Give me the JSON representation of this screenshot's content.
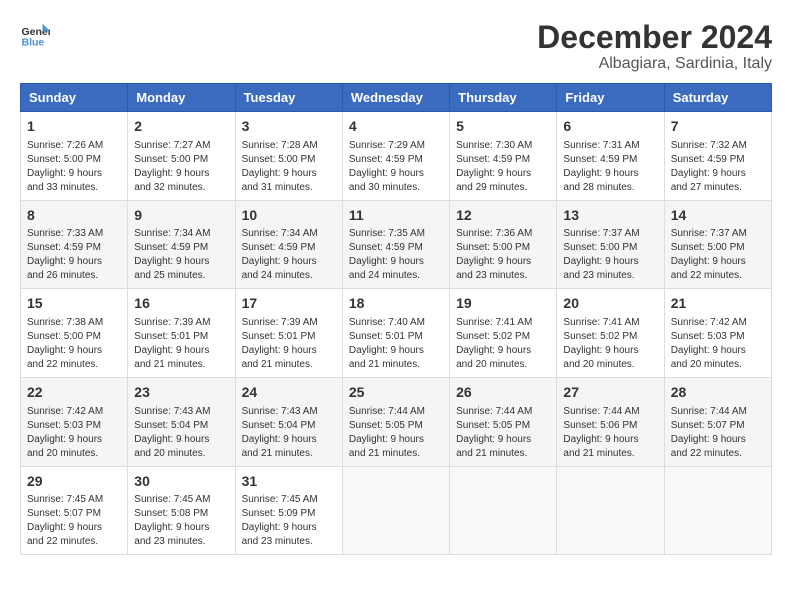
{
  "header": {
    "logo_line1": "General",
    "logo_line2": "Blue",
    "month": "December 2024",
    "location": "Albagiara, Sardinia, Italy"
  },
  "weekdays": [
    "Sunday",
    "Monday",
    "Tuesday",
    "Wednesday",
    "Thursday",
    "Friday",
    "Saturday"
  ],
  "weeks": [
    [
      {
        "day": "1",
        "sunrise": "7:26 AM",
        "sunset": "5:00 PM",
        "daylight": "9 hours and 33 minutes."
      },
      {
        "day": "2",
        "sunrise": "7:27 AM",
        "sunset": "5:00 PM",
        "daylight": "9 hours and 32 minutes."
      },
      {
        "day": "3",
        "sunrise": "7:28 AM",
        "sunset": "5:00 PM",
        "daylight": "9 hours and 31 minutes."
      },
      {
        "day": "4",
        "sunrise": "7:29 AM",
        "sunset": "4:59 PM",
        "daylight": "9 hours and 30 minutes."
      },
      {
        "day": "5",
        "sunrise": "7:30 AM",
        "sunset": "4:59 PM",
        "daylight": "9 hours and 29 minutes."
      },
      {
        "day": "6",
        "sunrise": "7:31 AM",
        "sunset": "4:59 PM",
        "daylight": "9 hours and 28 minutes."
      },
      {
        "day": "7",
        "sunrise": "7:32 AM",
        "sunset": "4:59 PM",
        "daylight": "9 hours and 27 minutes."
      }
    ],
    [
      {
        "day": "8",
        "sunrise": "7:33 AM",
        "sunset": "4:59 PM",
        "daylight": "9 hours and 26 minutes."
      },
      {
        "day": "9",
        "sunrise": "7:34 AM",
        "sunset": "4:59 PM",
        "daylight": "9 hours and 25 minutes."
      },
      {
        "day": "10",
        "sunrise": "7:34 AM",
        "sunset": "4:59 PM",
        "daylight": "9 hours and 24 minutes."
      },
      {
        "day": "11",
        "sunrise": "7:35 AM",
        "sunset": "4:59 PM",
        "daylight": "9 hours and 24 minutes."
      },
      {
        "day": "12",
        "sunrise": "7:36 AM",
        "sunset": "5:00 PM",
        "daylight": "9 hours and 23 minutes."
      },
      {
        "day": "13",
        "sunrise": "7:37 AM",
        "sunset": "5:00 PM",
        "daylight": "9 hours and 23 minutes."
      },
      {
        "day": "14",
        "sunrise": "7:37 AM",
        "sunset": "5:00 PM",
        "daylight": "9 hours and 22 minutes."
      }
    ],
    [
      {
        "day": "15",
        "sunrise": "7:38 AM",
        "sunset": "5:00 PM",
        "daylight": "9 hours and 22 minutes."
      },
      {
        "day": "16",
        "sunrise": "7:39 AM",
        "sunset": "5:01 PM",
        "daylight": "9 hours and 21 minutes."
      },
      {
        "day": "17",
        "sunrise": "7:39 AM",
        "sunset": "5:01 PM",
        "daylight": "9 hours and 21 minutes."
      },
      {
        "day": "18",
        "sunrise": "7:40 AM",
        "sunset": "5:01 PM",
        "daylight": "9 hours and 21 minutes."
      },
      {
        "day": "19",
        "sunrise": "7:41 AM",
        "sunset": "5:02 PM",
        "daylight": "9 hours and 20 minutes."
      },
      {
        "day": "20",
        "sunrise": "7:41 AM",
        "sunset": "5:02 PM",
        "daylight": "9 hours and 20 minutes."
      },
      {
        "day": "21",
        "sunrise": "7:42 AM",
        "sunset": "5:03 PM",
        "daylight": "9 hours and 20 minutes."
      }
    ],
    [
      {
        "day": "22",
        "sunrise": "7:42 AM",
        "sunset": "5:03 PM",
        "daylight": "9 hours and 20 minutes."
      },
      {
        "day": "23",
        "sunrise": "7:43 AM",
        "sunset": "5:04 PM",
        "daylight": "9 hours and 20 minutes."
      },
      {
        "day": "24",
        "sunrise": "7:43 AM",
        "sunset": "5:04 PM",
        "daylight": "9 hours and 21 minutes."
      },
      {
        "day": "25",
        "sunrise": "7:44 AM",
        "sunset": "5:05 PM",
        "daylight": "9 hours and 21 minutes."
      },
      {
        "day": "26",
        "sunrise": "7:44 AM",
        "sunset": "5:05 PM",
        "daylight": "9 hours and 21 minutes."
      },
      {
        "day": "27",
        "sunrise": "7:44 AM",
        "sunset": "5:06 PM",
        "daylight": "9 hours and 21 minutes."
      },
      {
        "day": "28",
        "sunrise": "7:44 AM",
        "sunset": "5:07 PM",
        "daylight": "9 hours and 22 minutes."
      }
    ],
    [
      {
        "day": "29",
        "sunrise": "7:45 AM",
        "sunset": "5:07 PM",
        "daylight": "9 hours and 22 minutes."
      },
      {
        "day": "30",
        "sunrise": "7:45 AM",
        "sunset": "5:08 PM",
        "daylight": "9 hours and 23 minutes."
      },
      {
        "day": "31",
        "sunrise": "7:45 AM",
        "sunset": "5:09 PM",
        "daylight": "9 hours and 23 minutes."
      },
      null,
      null,
      null,
      null
    ]
  ]
}
